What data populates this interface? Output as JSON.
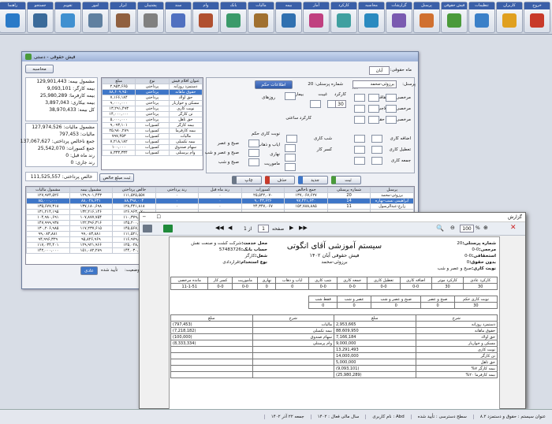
{
  "menubar": {
    "items": [
      {
        "label": "خروج",
        "color": "#c83a2a"
      },
      {
        "label": "کاربران",
        "color": "#e0a020"
      },
      {
        "label": "تنظیمات",
        "color": "#3b80c8"
      },
      {
        "label": "فیش حقوقی",
        "color": "#4a9a3a"
      },
      {
        "label": "پرسنل",
        "color": "#d07030"
      },
      {
        "label": "گزارشات",
        "color": "#7a5ab0"
      },
      {
        "label": "محاسبه",
        "color": "#2a8ac0"
      },
      {
        "label": "کارکرد",
        "color": "#40a0a0"
      },
      {
        "label": "آمار",
        "color": "#c04080"
      },
      {
        "label": "بیمه",
        "color": "#3070b0"
      },
      {
        "label": "مالیات",
        "color": "#a07030"
      },
      {
        "label": "بانک",
        "color": "#3a9a6a"
      },
      {
        "label": "وام",
        "color": "#b05030"
      },
      {
        "label": "سند",
        "color": "#5070c0"
      },
      {
        "label": "پشتیبان",
        "color": "#808080"
      },
      {
        "label": "ابزار",
        "color": "#906040"
      },
      {
        "label": "امور",
        "color": "#6080a0"
      },
      {
        "label": "تقویم",
        "color": "#4090d0"
      },
      {
        "label": "جستجو",
        "color": "#3a6a9a"
      },
      {
        "label": "راهنما",
        "color": "#2a7ac8"
      }
    ]
  },
  "win1": {
    "title": "فیش حقوقی - دستی",
    "left_summary": [
      "مشمول بیمه: 129,901,443",
      "بیمه کارگر: 9,093,101",
      "بیمه کارفرما: 25,980,289",
      "بیمه بیکاری: 3,897,043",
      "کل بیمه: 38,970,433",
      "مشمول مالیات: 127,974,526",
      "مالیات: 797,453",
      "جمع ناخالص پرداختی: 137,067,627",
      "جمع کسورات: 25,542,070",
      "رند ماه قبل: 0",
      "رند جاری: 0"
    ],
    "net_pay": "خالص پرداختی: 111,525,557",
    "month_label": "ماه حقوقی:",
    "month_value": "آبان",
    "year_value": "1402",
    "person_label": "پرسنل:",
    "person_value": "برزوئی-محمد",
    "pnum_label": "شماره پرسنلی: 20",
    "info_btn": "اطلاعات حکم",
    "fields": {
      "overtime": "مرخصی استحقاقی",
      "sick": "مرخصی استعلاجی",
      "unpaid": "مرخصی بدون حقوق",
      "day": "روز",
      "hour": "ساعت",
      "minute": "دقیقه",
      "workday": "روزهای",
      "work_hours": "کارکرد ساعتی",
      "illness": "بیماری",
      "absent": "غیبت",
      "work": "کارکرد",
      "overtime2": "اضافه کاری",
      "holiday": "تعطیل کاری",
      "friday": "جمعه کاری",
      "night": "شب کاری",
      "shortfall": "کسر کار",
      "shift": "نوبت کاری حکم",
      "morning_eve": "صبح و عصر",
      "morning_night": "صبح و عصر و شب",
      "morning_night2": "صبح و شب",
      "night_only": "فقط شب",
      "trip": "ایاب و ذهاب",
      "day_off": "نهاری",
      "mission": "ماموریت",
      "shift_work": "نوبت کاری"
    },
    "value_30": "30",
    "items_header": [
      "عنوان اقلام فیش",
      "نوع",
      "مبلغ"
    ],
    "items": [
      [
        "دستمزد روزانه",
        "پرداختی",
        "۲,۹۵۳,۶۶۵"
      ],
      [
        "حقوق ماهانه",
        "پرداختی",
        "۸۸,۶۰۹,۹۵۰"
      ],
      [
        "حق اولاد",
        "پرداختی",
        "۷,۱۶۶,۱۸۴"
      ],
      [
        "مسکن و خواربار",
        "پرداختی",
        "۹,۰۰۰,۰۰۰"
      ],
      [
        "نوبت کاری",
        "پرداختی",
        "۱۳,۲۹۱,۴۹۳"
      ],
      [
        "تن کارگر",
        "پرداختی",
        "۱۴,۰۰۰,۰۰۰"
      ],
      [
        "حق تاهل",
        "پرداختی",
        "۵,۰۰۰,۰۰۰"
      ],
      [
        "بیمه کارگر",
        "کسورات",
        "۹,۰۹۳,۱۰۱"
      ],
      [
        "بیمه کارفرما",
        "کسورات",
        "۲۵,۹۸۰,۲۸۹"
      ],
      [
        "مالیات",
        "کسورات",
        "۷۹۷,۴۵۳"
      ],
      [
        "بیمه تکمیلی",
        "کسورات",
        "۷,۲۱۸,۱۸۲"
      ],
      [
        "سهام صندوق",
        "کسورات",
        "۱۰۰,۰۰۰"
      ],
      [
        "وام پرسنلی",
        "کسورات",
        "۸,۳۳۳,۳۳۴"
      ]
    ],
    "buttons": {
      "save": "ثبت",
      "new": "جدید",
      "delete": "حذف",
      "print": "چاپ",
      "calc": "محاسبه",
      "tab_net": "ثبت مبلغ خالص",
      "status_label": "وضعیت:",
      "confirmed": "تأیید شده",
      "normal": "عادی"
    },
    "grid_header": [
      "پرسنل",
      "شماره پرسنلی",
      "جمع ناخالص",
      "کسورات",
      "رند ماه قبل",
      "رند پرداختی",
      "خالص پرداختی",
      "مشمول بیمه",
      "مشمول مالیات"
    ],
    "grid_rows": [
      [
        "برزوئی-محمد",
        "20",
        "۱۳۷,۰۶۷,۶۲۷",
        "۲۵,۵۴۲,۰۷۰",
        "٠",
        "٠",
        "۱۱۱,۵۲۵,۵۵۷",
        "۱۲۹,۹۰۱,۴۴۳",
        "۱۲۷,۹۷۴,۵۲۶"
      ],
      [
        "ابراهیمی نسب-بهاره",
        "14",
        "۹۷,۴۴۱,۶۳۰",
        "۹,۰۴۳,۶۲۶",
        "٠",
        "٠",
        "۸۸,۳۹۸,۰۰۴",
        "۸۸,۰۲۸,۶۳۱",
        "۸۵,۰۰۰,۰۰۰"
      ],
      [
        "زارع-عبدالرسول",
        "11",
        "۱۵۲,۷۸۸,۸۸۵",
        "۲۴,۳۴۷,۰۶۷",
        "٠",
        "٠",
        "۱۲۸,۴۴۱,۸۱۸",
        "۱۳۷,۱۸۰,۶۹۸",
        "۱۳۵,۶۷۷,۳۱۸"
      ],
      [
        "",
        "",
        "",
        "",
        "",
        "",
        "۱۲۶,۹۶۳,۰۷۰",
        "۱۳۲,۲۱۶,۱۴۶",
        "۱۳۱,۲۱۴,۱۹۵"
      ],
      [
        "",
        "",
        "",
        "",
        "",
        "",
        "۱۱۰,۳۷۹,۸۹۰",
        "۱۰۷,۸۷۷,۷۵۴",
        "۱۰۴,۹۸۰,۶۹۱"
      ],
      [
        "",
        "",
        "",
        "",
        "",
        "",
        "۱۴۵,۲۰۰,۱۵۱",
        "۱۲۲,۳۹۶,۳۱۶",
        "۱۴۷,۹۹۹,۹۳۸"
      ],
      [
        "",
        "",
        "",
        "",
        "",
        "",
        "۱۴۵,۵۶۷,۶۰۹",
        "۱۱۷,۲۳۷,۶۱۵",
        "۱۳۰,۲۰۶,۹۸۵"
      ],
      [
        "",
        "",
        "",
        "",
        "",
        "",
        "۱۱۱,۵۲۱,۶۱۶",
        "۹۹,۰۸۳,۸۸۱",
        "۹۹,۰۸۳,۸۸۱"
      ],
      [
        "",
        "",
        "",
        "",
        "",
        "",
        "۱۱۶,۹۷۹,۵۴۵",
        "۹۵,۸۲۶,۹۶۹",
        "۹۴,۹۹۶,۳۲۹"
      ],
      [
        "",
        "",
        "",
        "",
        "",
        "",
        "۱۲۵,۰۲۸,۱۳۹",
        "۱۲۹,۹۲۱,۹۶۶",
        "۱۱۷,۰۳۴,۴۰۱"
      ],
      [
        "",
        "",
        "",
        "",
        "",
        "",
        "۱۴۴,۰۳۰,۰۸۵",
        "۱۵۱,۰۸۲,۲۸۹",
        "۱۴۲,۰۰۰,۰۰۰"
      ]
    ]
  },
  "win2": {
    "title": "گزارش",
    "page_label": "صفحه",
    "page_current": "1",
    "page_total": "از 1",
    "zoom": "100",
    "report_title": "سیستم آموزشی آقای انگوتی",
    "report_subtitle": "فیش حقوقی آبان ۱۴۰۲",
    "report_person": "برزوئی-محمد",
    "meta": [
      [
        "شماره پرسنلی:",
        "20"
      ],
      [
        "مرجعی:",
        "0-0"
      ],
      [
        "استحقاقی:",
        "0-0"
      ],
      [
        "بدون حقوق:",
        "0"
      ],
      [
        "نوبت کاری:",
        "صبح و عصر و شب"
      ]
    ],
    "meta2": [
      [
        "محل خدمت:",
        "شرکت کشت و صنعت نقش"
      ],
      [
        "حساب بانک:",
        "57483726"
      ],
      [
        "شغل:",
        "کارگر"
      ],
      [
        "نوع استخدام:",
        "قراردادی"
      ]
    ],
    "attend_head": [
      "کارکرد عادی",
      "کارکرد موثر",
      "اضافه کاری",
      "تعطیل کاری",
      "جمعه کاری",
      "شب کاری",
      "ایاب و ذهاب",
      "نهاری",
      "ماموریت",
      "کسر کار",
      "مانده مرخصی"
    ],
    "attend_vals": [
      "30",
      "30",
      "0-0",
      "0-0",
      "0-0",
      "0-0",
      "0",
      "0",
      "0-0",
      "0-0",
      "11-1-51"
    ],
    "shift_head": [
      "نوبت کاری حکم",
      "صبح و عصر",
      "صبح و عصر و شب",
      "عصر و شب",
      "فقط شب"
    ],
    "shift_vals": [
      "30",
      "0",
      "0",
      "0",
      "0"
    ],
    "pay_head": [
      "شرح",
      "مبلغ",
      "شرح",
      "مبلغ"
    ],
    "pay_rows": [
      [
        "دستمزد روزانه",
        "2,953,665",
        "مالیات",
        "(797,453)"
      ],
      [
        "حقوق ماهانه",
        "88,609,950",
        "بیمه تکمیلی",
        "(7,218,182)"
      ],
      [
        "حق اولاد",
        "7,166,184",
        "سهام صندوق",
        "(100,000)"
      ],
      [
        "مسکن و خواربار",
        "9,000,000",
        "وام پرسنلی",
        "(8,333,334)"
      ],
      [
        "نوبت کاری",
        "13,291,493",
        "",
        ""
      ],
      [
        "تن کارگر",
        "14,000,000",
        "",
        ""
      ],
      [
        "حق تاهل",
        "5,000,000",
        "",
        ""
      ],
      [
        "بیمه کارگر ۷%",
        "(9,093,101)",
        "",
        ""
      ],
      [
        "بیمه کارفرما ۲۰%",
        "(25,980,289)",
        "",
        ""
      ]
    ]
  },
  "status": {
    "items": [
      "عنوان سیستم : حقوق و دستمزد ۸.۲",
      "سطح دسترسی : تأیید شده",
      "Abd : نام کاربری",
      "سال مالی فعال : ۱۴۰۲",
      "جمعه ۲۲ آذر ۱۴۰۲"
    ]
  }
}
